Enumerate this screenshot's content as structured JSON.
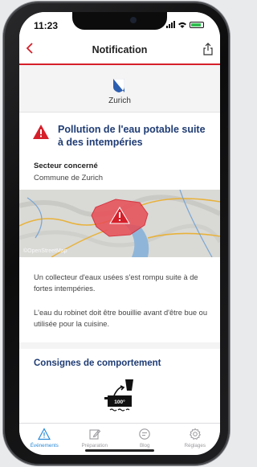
{
  "status": {
    "time": "11:23"
  },
  "nav": {
    "title": "Notification"
  },
  "header": {
    "location": "Zurich"
  },
  "alert": {
    "title": "Pollution de l'eau potable suite à des intempéries",
    "sector_label": "Secteur concerné",
    "sector_value": "Commune de Zurich"
  },
  "map": {
    "credit": "©OpenStreetMap"
  },
  "body": {
    "paragraph1": "Un collecteur d'eaux usées s'est rompu suite à de fortes intempéries.",
    "paragraph2": "L'eau du robinet doit être bouillie avant d'être bue ou utilisée pour la cuisine."
  },
  "section": {
    "title": "Consignes de comportement",
    "icon_label": "100°"
  },
  "tabs": [
    {
      "label": "Événements",
      "icon": "alert-icon",
      "active": true
    },
    {
      "label": "Préparation",
      "icon": "edit-icon",
      "active": false
    },
    {
      "label": "Blog",
      "icon": "blog-icon",
      "active": false
    },
    {
      "label": "Réglages",
      "icon": "gear-icon",
      "active": false
    }
  ],
  "colors": {
    "accent_red": "#d51f2a",
    "title_blue": "#1f3c74",
    "tab_active": "#2a8ad7"
  }
}
